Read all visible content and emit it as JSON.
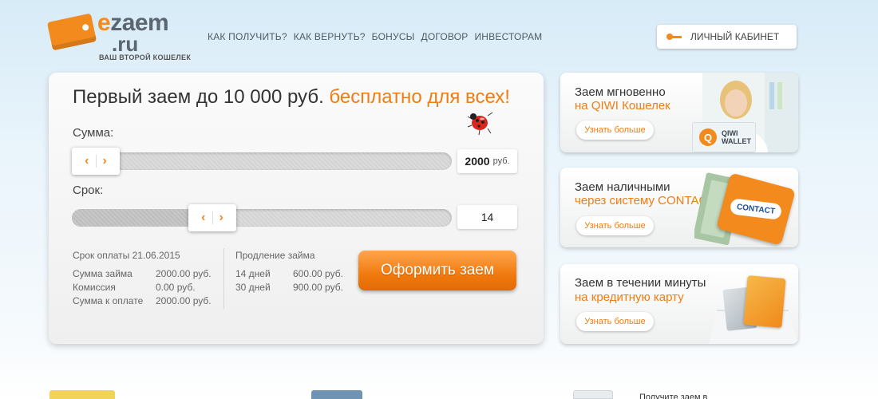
{
  "logo": {
    "brand_e": "e",
    "brand_rest": "zaem",
    "brand_ru": ".ru",
    "tagline": "ВАШ ВТОРОЙ КОШЕЛЕК"
  },
  "nav": [
    {
      "label": "КАК ПОЛУЧИТЬ?"
    },
    {
      "label": "КАК ВЕРНУТЬ?"
    },
    {
      "label": "БОНУСЫ"
    },
    {
      "label": "ДОГОВОР"
    },
    {
      "label": "ИНВЕСТОРАМ"
    }
  ],
  "cabinet": {
    "label": "ЛИЧНЫЙ КАБИНЕТ",
    "icon": "key-icon"
  },
  "calculator": {
    "headline": "Первый заем до 10 000 руб.",
    "headline_accent": "бесплатно для всех!",
    "amount_label": "Сумма:",
    "amount_value": "2000",
    "amount_unit": "руб.",
    "amount_level": 0.0,
    "term_label": "Срок:",
    "term_value": "14",
    "term_level": 0.35,
    "due_label": "Срок оплаты 21.06.2015",
    "summary": [
      {
        "k": "Сумма займа",
        "v": "2000.00 руб."
      },
      {
        "k": "Комиссия",
        "v": "0.00 руб."
      },
      {
        "k": "Сумма к оплате",
        "v": "2000.00 руб."
      }
    ],
    "extension_label": "Продление займа",
    "extension": [
      {
        "k": "14 дней",
        "v": "600.00 руб."
      },
      {
        "k": "30 дней",
        "v": "900.00 руб."
      }
    ],
    "cta": "Оформить заем"
  },
  "promos": [
    {
      "line1": "Заем мгновенно",
      "line2": "на QIWI  Кошелек",
      "more": "Узнать больше",
      "badge": "QIWI\nWALLET"
    },
    {
      "line1": "Заем наличными",
      "line2": "через систему CONTACT",
      "more": "Узнать больше",
      "badge": "CONTACT"
    },
    {
      "line1": "Заем в течении минуты",
      "line2": "на кредитную карту",
      "more": "Узнать больше"
    }
  ],
  "bottom": {
    "partial_text": "Получите заем в"
  },
  "colors": {
    "accent": "#f07d12",
    "nav_text": "#4d5b66"
  }
}
